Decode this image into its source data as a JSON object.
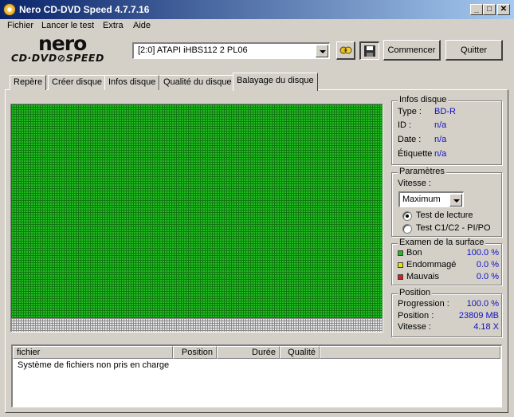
{
  "window": {
    "title": "Nero CD-DVD Speed 4.7.7.16",
    "controls": {
      "minimize": "_",
      "maximize": "□",
      "close": "✕"
    }
  },
  "menu": [
    "Fichier",
    "Lancer le test",
    "Extra",
    "Aide"
  ],
  "logo": {
    "top": "nero",
    "bottom": "CD·DVD⊘SPEED"
  },
  "toolbar": {
    "drive_value": "[2:0]   ATAPI iHBS112   2 PL06",
    "start_label": "Commencer",
    "quit_label": "Quitter",
    "refresh_icon": "refresh-icon",
    "save_icon": "save-icon"
  },
  "tabs": [
    {
      "label": "Repère",
      "active": false
    },
    {
      "label": "Créer disque",
      "active": false
    },
    {
      "label": "Infos disque",
      "active": false
    },
    {
      "label": "Qualité du disque",
      "active": false
    },
    {
      "label": "Balayage du disque",
      "active": true
    }
  ],
  "disc_info": {
    "title": "Infos disque",
    "type_label": "Type :",
    "type_value": "BD-R",
    "id_label": "ID :",
    "id_value": "n/a",
    "date_label": "Date :",
    "date_value": "n/a",
    "tag_label": "Étiquette",
    "tag_value": "n/a"
  },
  "params": {
    "title": "Paramètres",
    "speed_label": "Vitesse :",
    "speed_value": "Maximum",
    "read_test_label": "Test de lecture",
    "c1c2_label": "Test C1/C2 - PI/PO",
    "selected_mode": "read_test"
  },
  "surface": {
    "title": "Examen de la surface",
    "good_label": "Bon",
    "good_value": "100.0 %",
    "damaged_label": "Endommagé",
    "damaged_value": "0.0 %",
    "bad_label": "Mauvais",
    "bad_value": "0.0 %",
    "colors": {
      "good": "#22bb22",
      "damaged": "#e8e000",
      "bad": "#d02020",
      "unused": "#e8e8e8"
    },
    "scanned_fraction": 0.94
  },
  "position": {
    "title": "Position",
    "progress_label": "Progression :",
    "progress_value": "100.0 %",
    "pos_label": "Position :",
    "pos_value": "23809 MB",
    "speed_label": "Vitesse :",
    "speed_value": "4.18 X"
  },
  "list": {
    "columns": [
      "fichier",
      "Position",
      "Durée",
      "Qualité"
    ],
    "rows": [
      "Système de fichiers non pris en charge"
    ]
  }
}
